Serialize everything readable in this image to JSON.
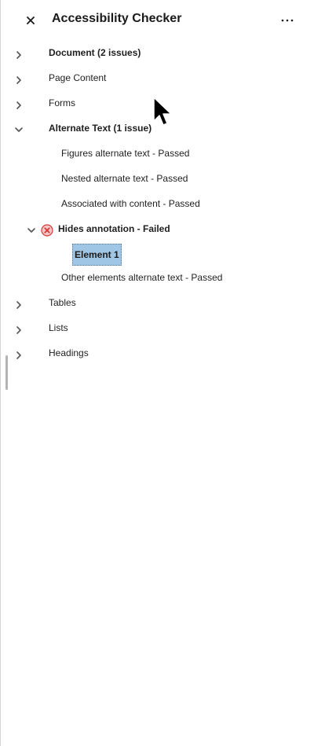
{
  "header": {
    "close_icon": "close-icon",
    "title": "Accessibility Checker",
    "more_icon": "more-icon"
  },
  "tree": {
    "document": "Document (2 issues)",
    "page_content": "Page Content",
    "forms": "Forms",
    "alternate_text": "Alternate Text (1 issue)",
    "figures_alt": "Figures alternate text - Passed",
    "nested_alt": "Nested alternate text - Passed",
    "associated": "Associated with content - Passed",
    "hides_annotation": "Hides annotation - Failed",
    "element_1": "Element 1",
    "other_elements": "Other elements alternate text - Passed",
    "tables": "Tables",
    "lists": "Lists",
    "headings": "Headings"
  },
  "colors": {
    "selected_bg": "#9fc6e4",
    "error": "#d93838"
  }
}
